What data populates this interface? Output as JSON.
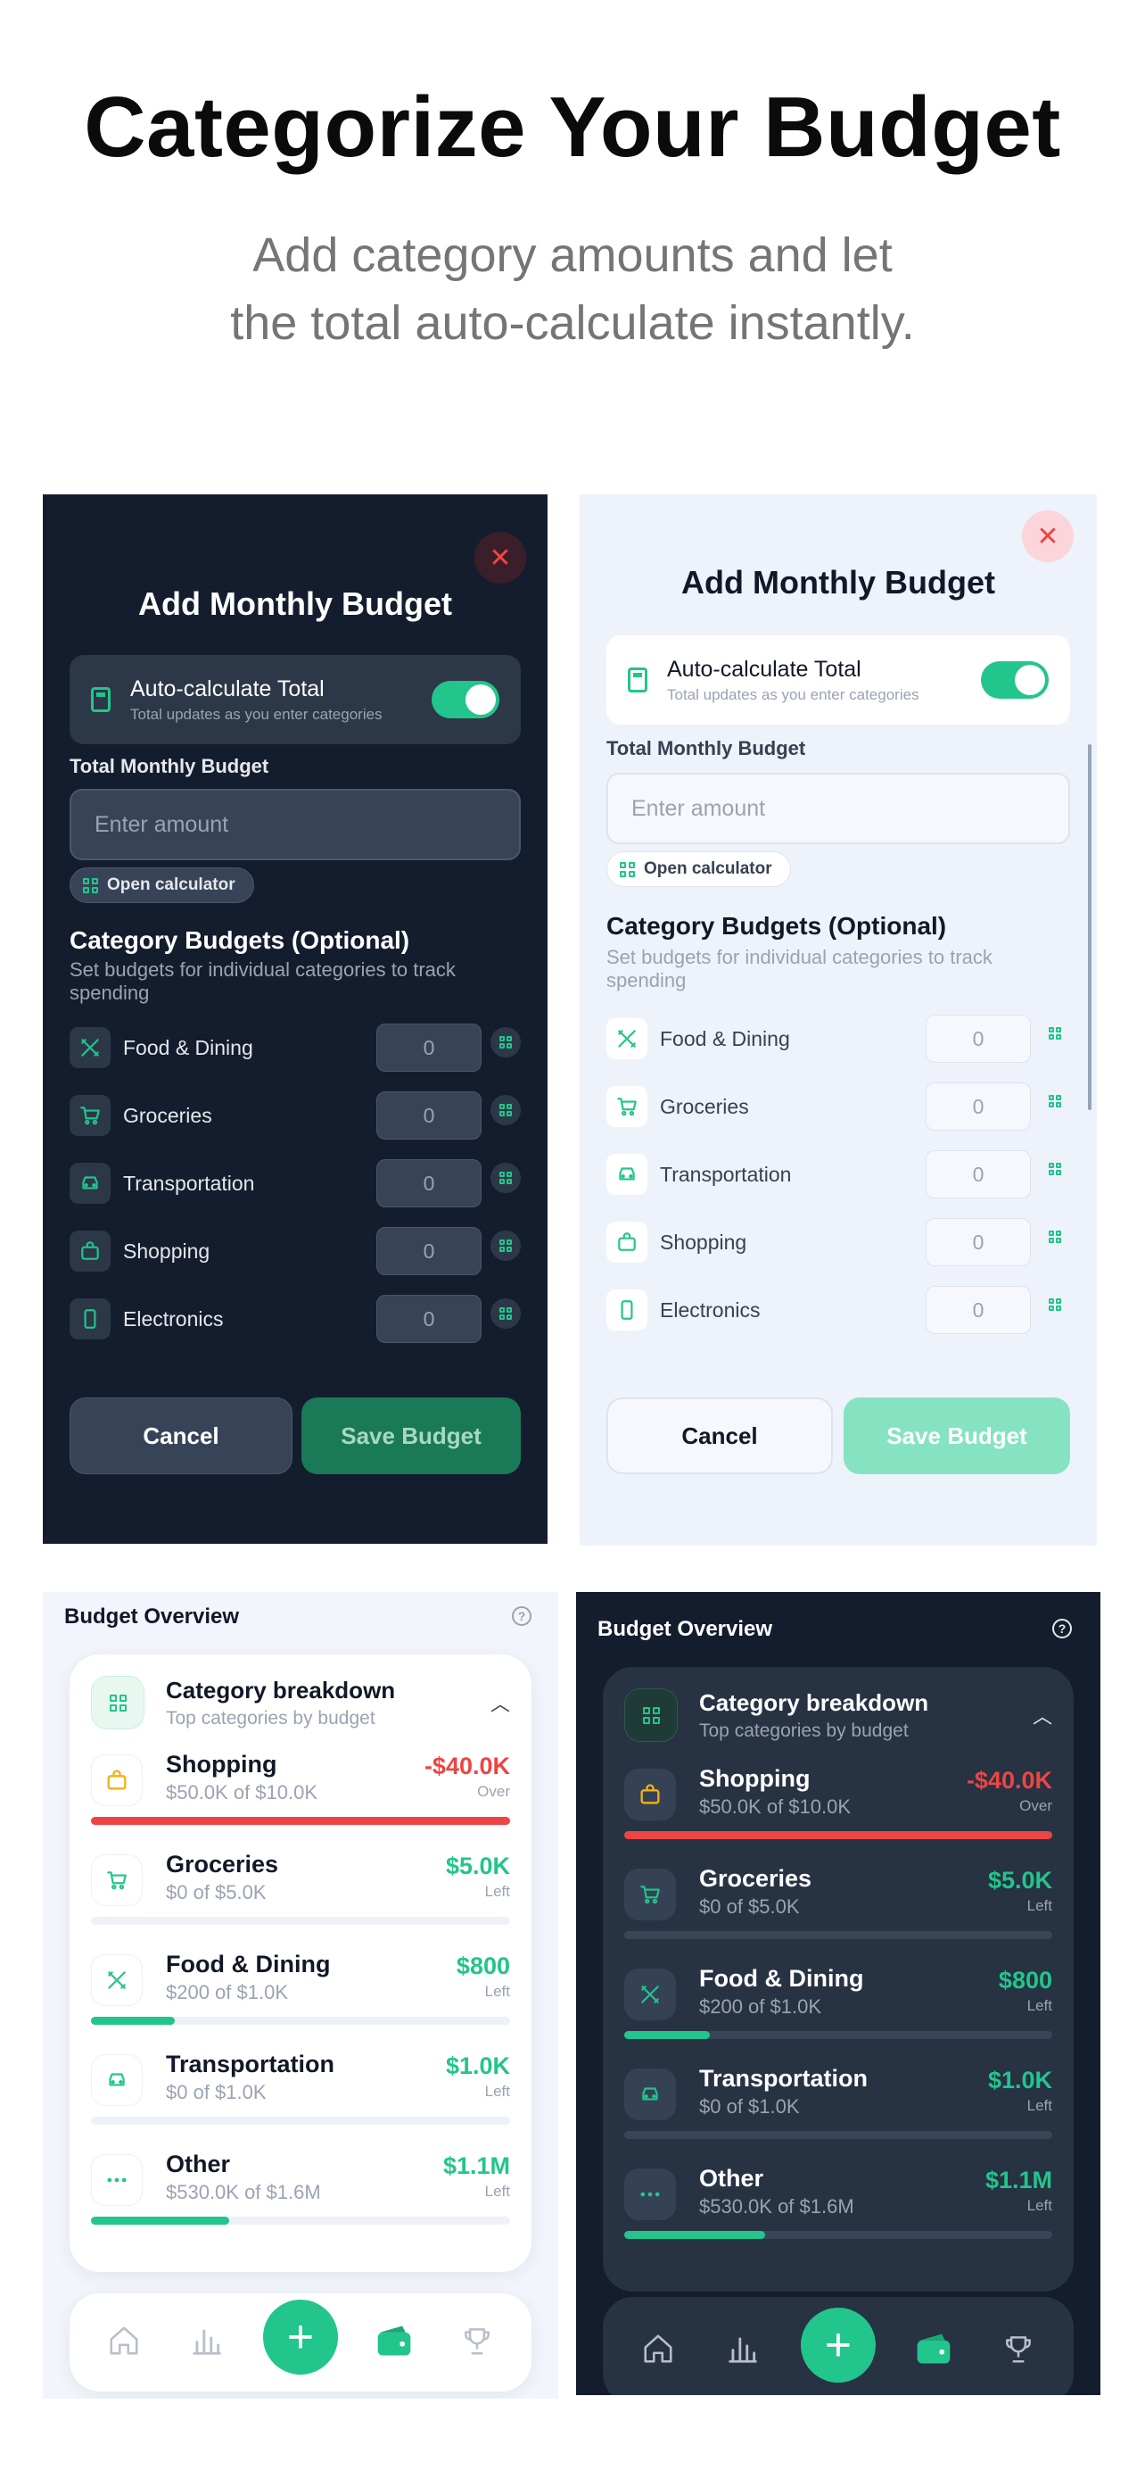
{
  "headline": "Categorize Your Budget",
  "subline_1": "Add category amounts and let",
  "subline_2": "the total auto-calculate instantly.",
  "modal": {
    "close_glyph": "✕",
    "title": "Add Monthly Budget",
    "auto_title": "Auto-calculate Total",
    "auto_sub": "Total updates as you enter categories",
    "auto_enabled": true,
    "total_label": "Total Monthly Budget",
    "amount_placeholder": "Enter amount",
    "open_calc_label": "Open calculator",
    "section_title": "Category Budgets (Optional)",
    "section_sub": "Set budgets for individual categories to track spending",
    "categories": [
      {
        "name": "Food & Dining",
        "value": "0",
        "icon": "utensils-icon"
      },
      {
        "name": "Groceries",
        "value": "0",
        "icon": "cart-icon"
      },
      {
        "name": "Transportation",
        "value": "0",
        "icon": "car-icon"
      },
      {
        "name": "Shopping",
        "value": "0",
        "icon": "bag-icon"
      },
      {
        "name": "Electronics",
        "value": "0",
        "icon": "phone-icon"
      }
    ],
    "cancel_label": "Cancel",
    "save_label": "Save Budget"
  },
  "overview": {
    "title": "Budget Overview",
    "help_glyph": "?",
    "card_title": "Category breakdown",
    "card_sub": "Top categories by budget",
    "items": [
      {
        "name": "Shopping",
        "sub": "$50.0K of $10.0K",
        "amount": "-$40.0K",
        "tag": "Over",
        "status": "over",
        "progress": 1.0,
        "icon": "bag-icon"
      },
      {
        "name": "Groceries",
        "sub": "$0 of $5.0K",
        "amount": "$5.0K",
        "tag": "Left",
        "status": "left",
        "progress": 0.0,
        "icon": "cart-icon"
      },
      {
        "name": "Food & Dining",
        "sub": "$200 of $1.0K",
        "amount": "$800",
        "tag": "Left",
        "status": "left",
        "progress": 0.2,
        "icon": "utensils-icon"
      },
      {
        "name": "Transportation",
        "sub": "$0 of $1.0K",
        "amount": "$1.0K",
        "tag": "Left",
        "status": "left",
        "progress": 0.0,
        "icon": "car-icon"
      },
      {
        "name": "Other",
        "sub": "$530.0K of $1.6M",
        "amount": "$1.1M",
        "tag": "Left",
        "status": "left",
        "progress": 0.33,
        "icon": "dots-icon"
      }
    ],
    "tabs": [
      "home-icon",
      "chart-icon",
      "add-icon",
      "wallet-icon",
      "trophy-icon"
    ],
    "fab_glyph": "+"
  },
  "colors": {
    "accent": "#22c58b",
    "danger": "#ef4444",
    "dark_bg": "#141d2e",
    "light_bg": "#eef2fb",
    "shopping_icon": "#f5b014"
  }
}
